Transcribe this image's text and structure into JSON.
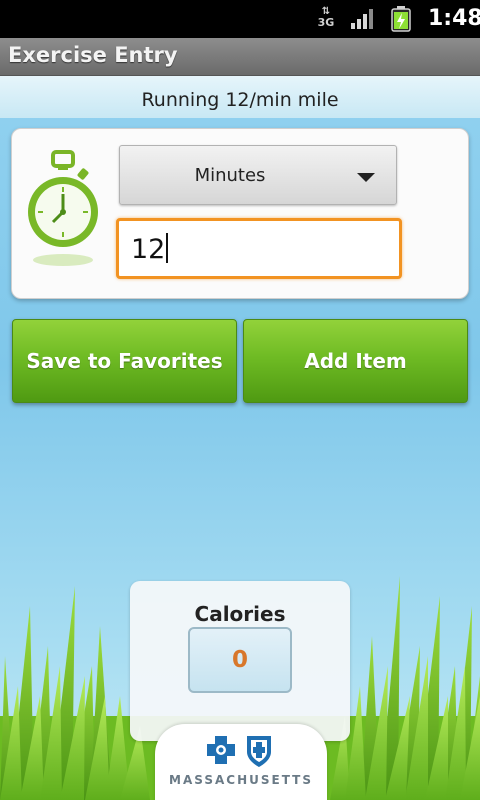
{
  "status_bar": {
    "network": "3G",
    "time": "1:48",
    "battery_color": "#8ee035"
  },
  "app": {
    "title": "Exercise Entry"
  },
  "exercise": {
    "name": "Running 12/min mile",
    "icon": "stopwatch-icon"
  },
  "entry": {
    "unit_options_selected": "Minutes",
    "amount_value": "12"
  },
  "actions": {
    "save_favorites_label": "Save to Favorites",
    "add_item_label": "Add Item"
  },
  "calories": {
    "label": "Calories",
    "value": "0"
  },
  "brand": {
    "text": "MASSACHUSETTS",
    "logos": [
      "blue-cross-icon",
      "blue-shield-icon"
    ]
  },
  "colors": {
    "accent_orange": "#f29322",
    "button_green": "#6fbb24",
    "brand_blue": "#1f6fb2"
  }
}
